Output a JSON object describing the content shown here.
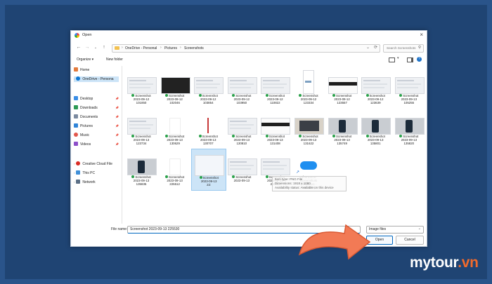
{
  "dialog": {
    "title": "Open",
    "breadcrumb": [
      "OneDrive - Personal",
      "Pictures",
      "Screenshots"
    ],
    "search_placeholder": "Search Screenshots",
    "toolbar": {
      "organize": "Organize ▾",
      "new_folder": "New folder"
    },
    "sidebar": [
      {
        "label": "Home",
        "icon": "home-icon",
        "pinned": false
      },
      {
        "label": "OneDrive - Persona",
        "icon": "cloud-icon",
        "pinned": false,
        "selected": true
      },
      {
        "label": "Desktop",
        "icon": "desktop-icon",
        "pinned": true
      },
      {
        "label": "Downloads",
        "icon": "download-icon",
        "pinned": true
      },
      {
        "label": "Documents",
        "icon": "document-icon",
        "pinned": true
      },
      {
        "label": "Pictures",
        "icon": "pictures-icon",
        "pinned": true
      },
      {
        "label": "Music",
        "icon": "music-icon",
        "pinned": true
      },
      {
        "label": "Videos",
        "icon": "video-icon",
        "pinned": true
      },
      {
        "label": "Creative Cloud File",
        "icon": "creative-cloud-icon",
        "pinned": false
      },
      {
        "label": "This PC",
        "icon": "pc-icon",
        "pinned": false
      },
      {
        "label": "Network",
        "icon": "network-icon",
        "pinned": false
      }
    ],
    "files": [
      {
        "l1": "Screenshot",
        "l2": "2023-09-12",
        "l3": "101850"
      },
      {
        "l1": "Screenshot",
        "l2": "2023-09-12",
        "l3": "102046"
      },
      {
        "l1": "Screenshot",
        "l2": "2023-09-12",
        "l3": "103854"
      },
      {
        "l1": "Screenshot",
        "l2": "2023-09-12",
        "l3": "103950"
      },
      {
        "l1": "Screenshot",
        "l2": "2023-09-12",
        "l3": "110822"
      },
      {
        "l1": "Screenshot",
        "l2": "2023-09-12",
        "l3": "123334"
      },
      {
        "l1": "Screenshot",
        "l2": "2023-09-12",
        "l3": "123557"
      },
      {
        "l1": "Screenshot",
        "l2": "2023-09-12",
        "l3": "123639"
      },
      {
        "l1": "Screenshot",
        "l2": "2023-09-13",
        "l3": "105255"
      },
      {
        "l1": "Screenshot",
        "l2": "2023-09-13",
        "l3": "123734"
      },
      {
        "l1": "Screenshot",
        "l2": "2023-09-13",
        "l3": "130629"
      },
      {
        "l1": "Screenshot",
        "l2": "2023-09-13",
        "l3": "130707"
      },
      {
        "l1": "Screenshot",
        "l2": "2023-09-13",
        "l3": "130810"
      },
      {
        "l1": "Screenshot",
        "l2": "2023-09-13",
        "l3": "131408"
      },
      {
        "l1": "Screenshot",
        "l2": "2023-09-13",
        "l3": "131622"
      },
      {
        "l1": "Screenshot",
        "l2": "2023-09-13",
        "l3": "135749"
      },
      {
        "l1": "Screenshot",
        "l2": "2023-09-13",
        "l3": "135801"
      },
      {
        "l1": "Screenshot",
        "l2": "2023-09-13",
        "l3": "135820"
      },
      {
        "l1": "Screenshot",
        "l2": "2023-09-13",
        "l3": "135835"
      },
      {
        "l1": "Screenshot",
        "l2": "2023-09-13",
        "l3": "225512"
      },
      {
        "l1": "Screenshot",
        "l2": "2023-09-13",
        "l3": "22:"
      },
      {
        "l1": "Screenshot",
        "l2": "2023-09-13",
        "l3": ""
      },
      {
        "l1": "Screenshot",
        "l2": "2023-09-13",
        "l3": "230:56"
      },
      {
        "l1": "Shortcut to",
        "l2": "Screenshots",
        "l3": "(OneDrive -",
        "l4": "Personal)"
      }
    ],
    "tooltip": [
      "Item type: PNG File",
      "Dimensions: 1918 x 1080",
      "Availability status: Available on this device"
    ],
    "filename_label": "File name:",
    "filename_value": "Screenshot 2023-09-13 225530",
    "filetype_value": "Image files",
    "open_label": "Open",
    "cancel_label": "Cancel"
  },
  "watermark": {
    "brand": "mytour",
    "tld": ".vn"
  },
  "colors": {
    "accent": "#0067c0",
    "arrow": "#f27a55",
    "selection": "#cce4f7"
  }
}
